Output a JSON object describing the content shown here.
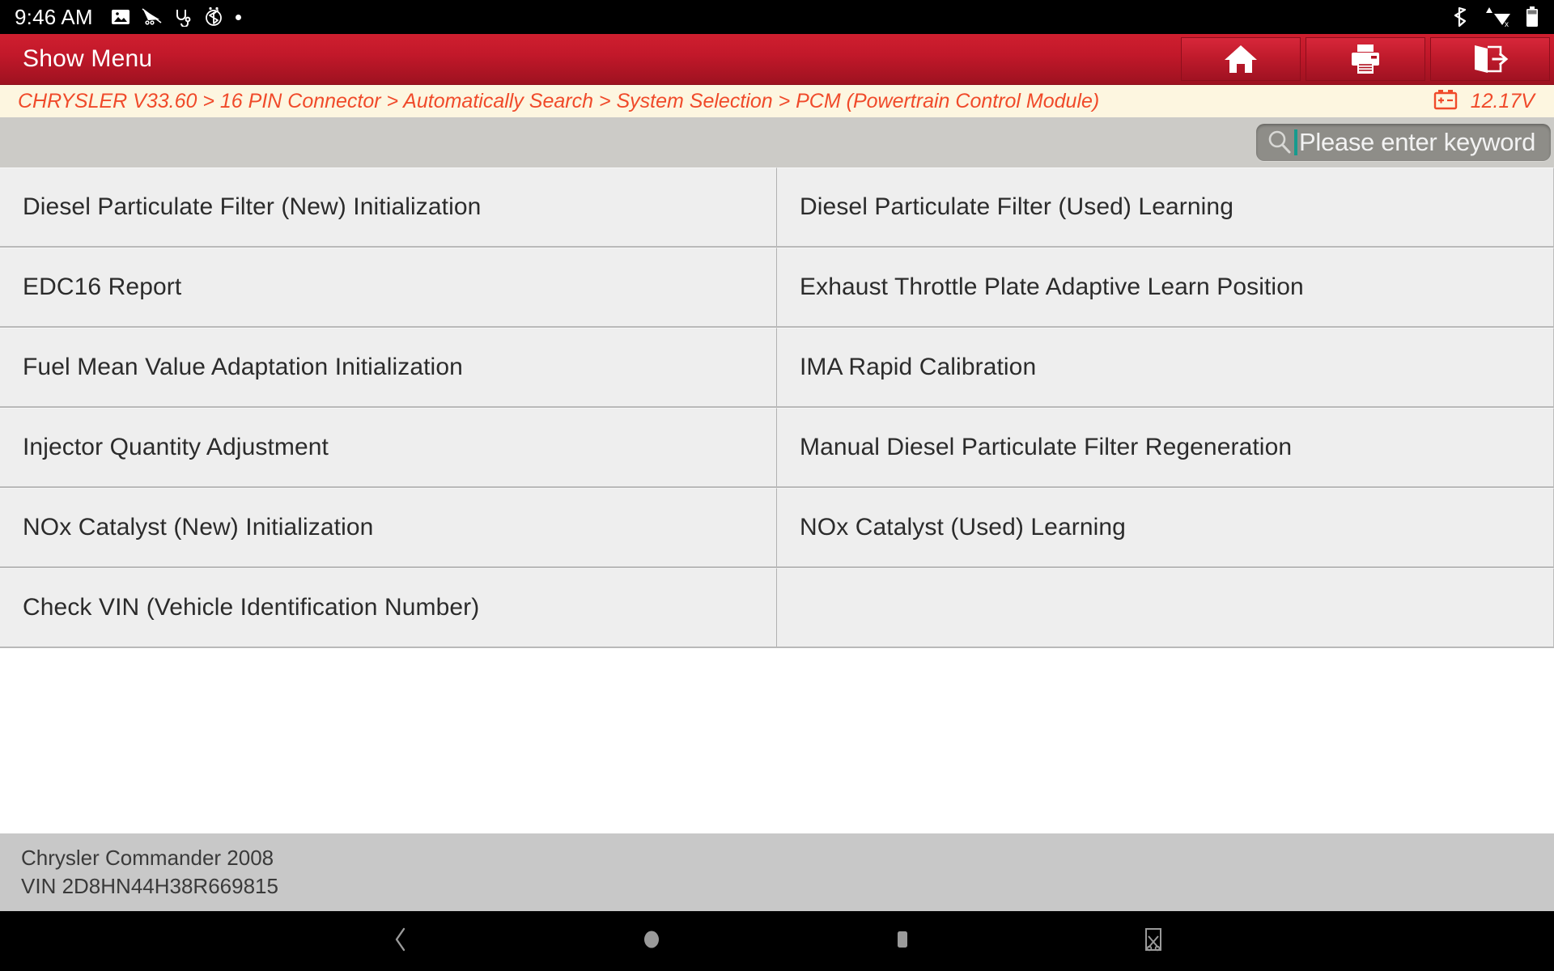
{
  "status_bar": {
    "time": "9:46 AM",
    "left_icons": [
      "image-icon",
      "no-notification-icon",
      "stethoscope-icon",
      "bluetooth-searching-icon",
      "dot-icon"
    ],
    "right_icons": [
      "bluetooth-icon",
      "wifi-disconnected-icon",
      "battery-icon"
    ]
  },
  "title_bar": {
    "title": "Show Menu",
    "buttons": [
      {
        "name": "home-button",
        "icon": "home-icon"
      },
      {
        "name": "print-button",
        "icon": "print-icon"
      },
      {
        "name": "exit-button",
        "icon": "exit-icon"
      }
    ]
  },
  "breadcrumb": {
    "path": "CHRYSLER V33.60 > 16 PIN Connector > Automatically Search > System Selection > PCM (Powertrain Control Module)",
    "voltage": "12.17V",
    "voltage_icon": "battery-terminal-icon"
  },
  "search": {
    "icon": "search-icon",
    "placeholder": "Please enter keyword",
    "value": ""
  },
  "menu": {
    "rows": [
      {
        "left": "Diesel Particulate Filter (New) Initialization",
        "right": "Diesel Particulate Filter (Used) Learning"
      },
      {
        "left": "EDC16 Report",
        "right": "Exhaust Throttle Plate Adaptive Learn Position"
      },
      {
        "left": "Fuel Mean Value Adaptation Initialization",
        "right": "IMA Rapid Calibration"
      },
      {
        "left": "Injector Quantity Adjustment",
        "right": "Manual Diesel Particulate Filter Regeneration"
      },
      {
        "left": "NOx Catalyst (New) Initialization",
        "right": "NOx Catalyst (Used) Learning"
      },
      {
        "left": "Check VIN (Vehicle Identification Number)",
        "right": ""
      }
    ]
  },
  "footer": {
    "vehicle": "Chrysler Commander 2008",
    "vin": "VIN 2D8HN44H38R669815"
  },
  "nav_bar": {
    "buttons": [
      "back-icon",
      "home-circle-icon",
      "recents-square-icon",
      "screenshot-icon"
    ]
  },
  "colors": {
    "title_bar_red": "#c2182a",
    "breadcrumb_text": "#f04a2a",
    "breadcrumb_bg": "#fdf6e0",
    "cell_bg": "#eeeeee",
    "toolbar_bg": "#cccbc7",
    "footer_bg": "#c8c8c8",
    "caret_teal": "#169b8e"
  }
}
